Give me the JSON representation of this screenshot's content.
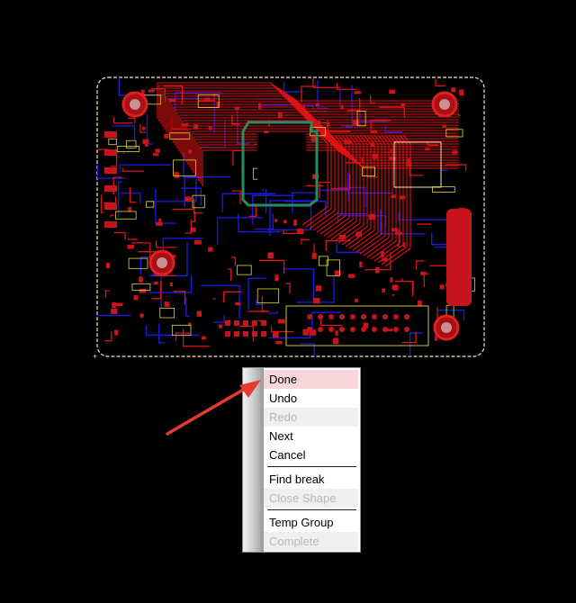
{
  "colors": {
    "background": "#000000",
    "board_outline": "#f2e6b4",
    "top_copper": "#e01212",
    "bottom_copper": "#1a1ad8",
    "silkscreen": "#e0d830",
    "keepout_green": "#2d8a60",
    "pad_red": "#c8141c",
    "arrow": "#e83a30"
  },
  "context_menu": {
    "items": [
      {
        "label": "Done",
        "state": "highlighted"
      },
      {
        "label": "Undo",
        "state": "enabled"
      },
      {
        "label": "Redo",
        "state": "disabled"
      },
      {
        "label": "Next",
        "state": "enabled"
      },
      {
        "label": "Cancel",
        "state": "enabled"
      },
      {
        "separator": true
      },
      {
        "label": "Find break",
        "state": "enabled"
      },
      {
        "label": "Close Shape",
        "state": "disabled"
      },
      {
        "separator": true
      },
      {
        "label": "Temp Group",
        "state": "enabled"
      },
      {
        "label": "Complete",
        "state": "disabled"
      }
    ]
  },
  "annotation": {
    "icon": "red-arrow-icon",
    "target": "Done"
  }
}
